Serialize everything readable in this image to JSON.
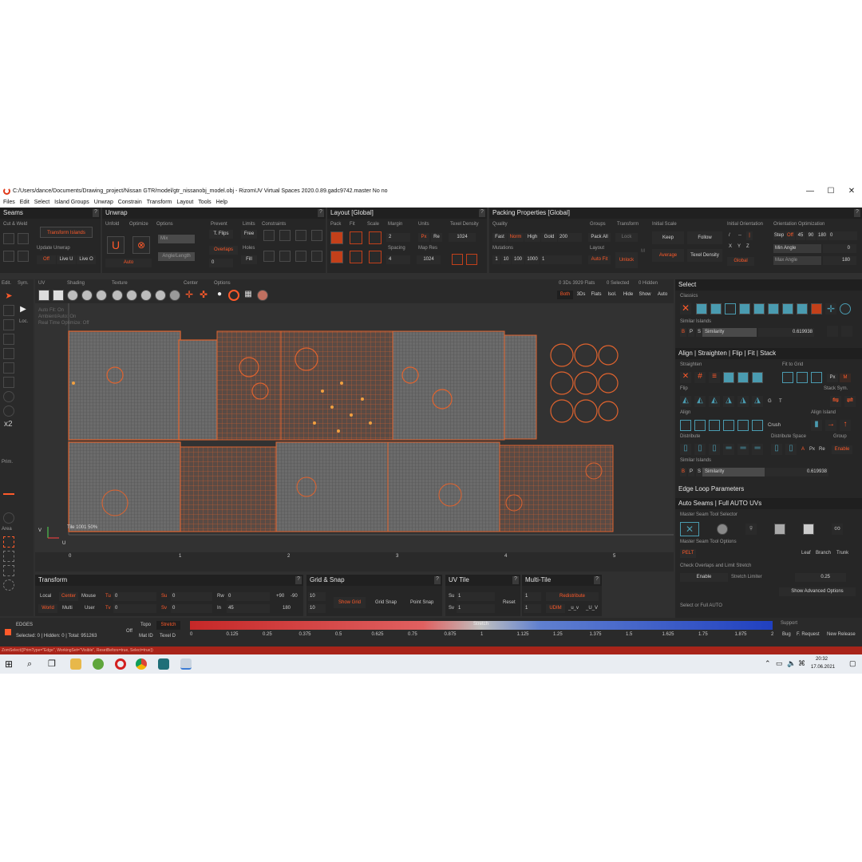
{
  "window": {
    "title": "C:/Users/dance/Documents/Drawing_project/Nissan GTR/model/gtr_nissanobj_model.obj - RizomUV  Virtual Spaces 2020.0.89.gadc9742.master No no",
    "minimize": "—",
    "maximize": "☐",
    "close": "✕"
  },
  "menu": [
    "Files",
    "Edit",
    "Select",
    "Island Groups",
    "Unwrap",
    "Constrain",
    "Transform",
    "Layout",
    "Tools",
    "Help"
  ],
  "seams": {
    "title": "Seams",
    "cut_weld": "Cut & Weld",
    "transform_islands": "Transform Islands",
    "update_unwrap": "Update Unwrap",
    "off": "Off",
    "live_u": "Live U",
    "live_o": "Live O"
  },
  "unwrap": {
    "title": "Unwrap",
    "unfold": "Unfold",
    "optimize": "Optimize",
    "options": "Options",
    "mix": "Mix",
    "angle_length": "Angle/Length",
    "zero": "0",
    "auto": "Auto",
    "prevent": "Prevent",
    "t_flips": "T. Flips",
    "overlaps": "Overlaps",
    "limits": "Limits",
    "free": "Free",
    "holes": "Holes",
    "fill": "Fill",
    "constraints": "Constraints"
  },
  "layout": {
    "title": "Layout [Global]",
    "pack": "Pack",
    "fit": "Fit",
    "scale": "Scale",
    "margin": "Margin",
    "margin_val": "2",
    "spacing": "Spacing",
    "spacing_val": "4",
    "units": "Units",
    "px": "Px",
    "re": "Re",
    "map_res": "Map Res",
    "map_res_val": "1024",
    "texel_density": "Texel Density",
    "td_val": "1024"
  },
  "packing": {
    "title": "Packing Properties [Global]",
    "quality": "Quality",
    "fast": "Fast",
    "norm": "Norm",
    "high": "High",
    "gold": "Gold",
    "gold_val": "200",
    "mutations": "Mutations",
    "m1": "1",
    "m10": "10",
    "m100": "100",
    "m1000": "1000",
    "m_val": "1",
    "groups": "Groups",
    "pack_all": "Pack All",
    "layout": "Layout",
    "auto_fit": "Auto Fit",
    "transform": "Transform",
    "lock": "Lock",
    "unlock": "Unlock",
    "initial_scale": "Initial Scale",
    "keep": "Keep",
    "follow": "Follow",
    "average": "Average",
    "texel_density": "Texel Density",
    "m": "M",
    "initial_orientation": "Initial Orientation",
    "global": "Global",
    "orientation_opt": "Orientation Optimization",
    "step": "Step",
    "off": "Off",
    "o45": "45",
    "o90": "90",
    "o180": "180",
    "o_val": "0",
    "min_angle": "Min Angle",
    "min_angle_val": "0",
    "max_angle": "Max Angle",
    "max_angle_val": "180",
    "x": "X",
    "y": "Y",
    "z": "Z"
  },
  "viewtoolbar": {
    "edit": "Edit.",
    "sym": "Sym.",
    "uv": "UV",
    "shading": "Shading",
    "texture": "Texture",
    "center": "Center",
    "options": "Options",
    "stats": "0 3Ds 3929 Flats",
    "selected": "0 Selected",
    "hidden": "0 Hidden",
    "both": "Both",
    "3ds": "3Ds",
    "flats": "Flats",
    "isol": "Isol.",
    "hide": "Hide",
    "show": "Show",
    "auto": "Auto"
  },
  "viewport": {
    "overlay1": "Auto Fit: On",
    "overlay2": "Ambient/Auto: On",
    "overlay3": "Real Time Optimize: Off",
    "tile_label": "Tile 1001 50%",
    "u_ticks": [
      "0",
      "1",
      "2",
      "3",
      "4",
      "5"
    ],
    "axis_u": "U",
    "axis_v": "V",
    "loc": "Loc.",
    "prim": "Prim.",
    "area": "Area",
    "x2": "x2"
  },
  "select": {
    "title": "Select",
    "classics": "Classics",
    "similar_islands": "Similar Islands",
    "b": "B",
    "p": "P",
    "s": "S",
    "similarity": "Similarity",
    "sim_val": "0.619938"
  },
  "align": {
    "title": "Align | Straighten | Flip | Fit | Stack",
    "straighten": "Straighten",
    "fit_to_grid": "Fit to Grid",
    "px": "Px",
    "m": "M",
    "flip": "Flip",
    "g": "G",
    "t": "T",
    "stack_sym": "Stack Sym.",
    "align": "Align",
    "align_island": "Align Island",
    "crush": "Crush",
    "distribute": "Distribute",
    "distribute_space": "Distribute Space",
    "group": "Group",
    "a": "A",
    "re": "Re",
    "enable": "Enable",
    "similar_islands": "Similar Islands",
    "similarity": "Similarity",
    "sim_val": "0.619938"
  },
  "edgeloop": {
    "title": "Edge Loop Parameters"
  },
  "autoseams": {
    "title": "Auto Seams | Full AUTO UVs",
    "master_selector": "Master Seam Tool Selector",
    "master_options": "Master Seam Tool Options",
    "pelt": "PELT",
    "leaf": "Leaf",
    "branch": "Branch",
    "trunk": "Trunk",
    "check_overlaps": "Check Overlaps and Limit Stretch",
    "enable": "Enable",
    "stretch_limiter": "Stretch Limiter",
    "stretch_val": "0.25",
    "show_advanced": "Show Advanced Options",
    "select_or_full": "Select or Full AUTO"
  },
  "transform": {
    "title": "Transform",
    "local": "Local",
    "center": "Center",
    "mouse": "Mouse",
    "world": "World",
    "multi": "Multi",
    "user": "User",
    "tu": "Tu",
    "tv": "Tv",
    "tu_val": "0",
    "tv_val": "0",
    "su": "Su",
    "sv": "Sv",
    "su_val": "0",
    "sv_val": "0",
    "rw": "Rw",
    "rw_val": "0",
    "in": "In",
    "in_val": "45",
    "p90": "+90",
    "m90": "-90",
    "r180": "180"
  },
  "gridsnap": {
    "title": "Grid & Snap",
    "v10a": "10",
    "v10b": "10",
    "show_grid": "Show Grid",
    "grid_snap": "Grid Snap",
    "point_snap": "Point Snap"
  },
  "uvtile": {
    "title": "UV Tile",
    "su": "Su",
    "su_val": "1",
    "sv": "Sv",
    "sv_val": "1",
    "reset": "Reset"
  },
  "multitile": {
    "title": "Multi-Tile",
    "v1a": "1",
    "v1b": "1",
    "redistribute": "Redistribute",
    "udim": "UDIM",
    "uv_a": "_u_v",
    "uv_b": "_U_V"
  },
  "status": {
    "mode": "EDGES",
    "counts": "Selected: 0 | Hidden: 0 | Total: 951263",
    "off": "Off",
    "topo": "Topo",
    "mat_id": "Mat ID",
    "stretch_btn": "Stretch",
    "texel_d": "Texel D",
    "stretch_label": "Stretch",
    "scale": [
      "0",
      "0.125",
      "0.25",
      "0.375",
      "0.5",
      "0.625",
      "0.75",
      "0.875",
      "1",
      "1.125",
      "1.25",
      "1.375",
      "1.5",
      "1.625",
      "1.75",
      "1.875",
      "2"
    ],
    "support": "Support",
    "bug": "Bug",
    "f_request": "F. Request",
    "new_release": "New Release"
  },
  "cmdline": "ZomSelect({PrimType=\"Edge\", WorkingSet=\"Visible\", ResetBefore=true, Select=true})",
  "taskbar": {
    "time": "20:32",
    "date": "17.06.2021"
  },
  "colors": {
    "accent": "#ff5a2a",
    "uv_orange": "#e0632e",
    "panel": "#262626",
    "background": "#303030"
  }
}
